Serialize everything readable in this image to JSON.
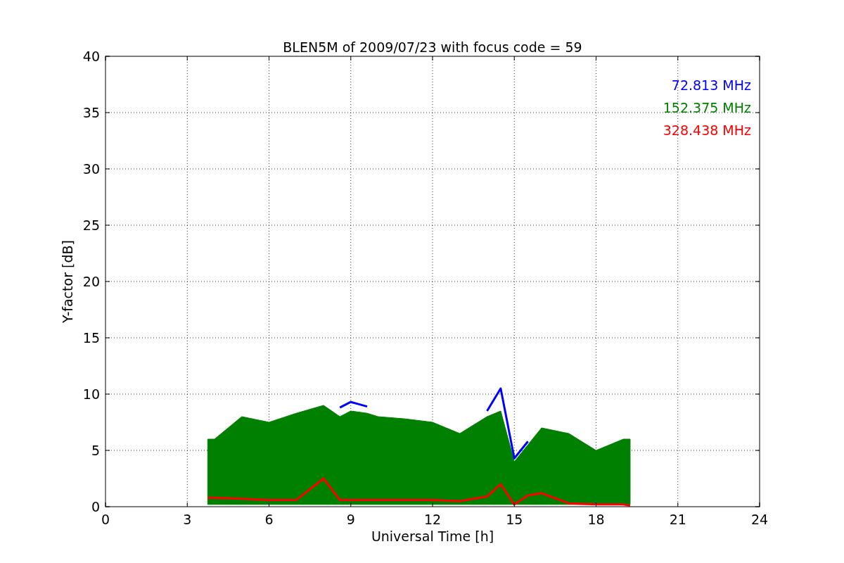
{
  "chart_data": {
    "type": "line",
    "title": "BLEN5M of 2009/07/23 with focus code = 59",
    "xlabel": "Universal Time [h]",
    "ylabel": "Y-factor [dB]",
    "x": [
      3.75,
      4,
      5,
      6,
      7,
      8,
      8.6,
      9,
      9.6,
      10,
      11,
      12,
      13,
      14,
      14.5,
      15,
      15.5,
      16,
      17,
      18,
      19,
      19.25
    ],
    "series": [
      {
        "name": "72.813 MHz",
        "color": "#0000ff",
        "values": [
          null,
          null,
          null,
          null,
          null,
          null,
          8.8,
          9.3,
          8.9,
          null,
          null,
          null,
          null,
          8.5,
          10.5,
          4.3,
          5.8,
          null,
          null,
          null,
          null,
          null
        ]
      },
      {
        "name": "152.375 MHz",
        "type": "area",
        "color": "#008000",
        "values": [
          6,
          6,
          8,
          7.5,
          8.3,
          9,
          8.0,
          8.5,
          8.3,
          8,
          7.8,
          7.5,
          6.5,
          8,
          8.5,
          4.0,
          5.5,
          7,
          6.5,
          5,
          6,
          6
        ]
      },
      {
        "name": "328.438 MHz",
        "color": "#ff0000",
        "values": [
          0.8,
          0.8,
          0.7,
          0.6,
          0.6,
          2.5,
          0.6,
          0.6,
          0.6,
          0.6,
          0.6,
          0.6,
          0.5,
          0.9,
          2,
          0.2,
          1,
          1.2,
          0.3,
          0.2,
          0.2,
          0.1
        ]
      }
    ],
    "xlim": [
      0,
      24
    ],
    "ylim": [
      0,
      40
    ],
    "xticks": [
      0,
      3,
      6,
      9,
      12,
      15,
      18,
      21,
      24
    ],
    "yticks": [
      0,
      5,
      10,
      15,
      20,
      25,
      30,
      35,
      40
    ],
    "grid": true
  }
}
